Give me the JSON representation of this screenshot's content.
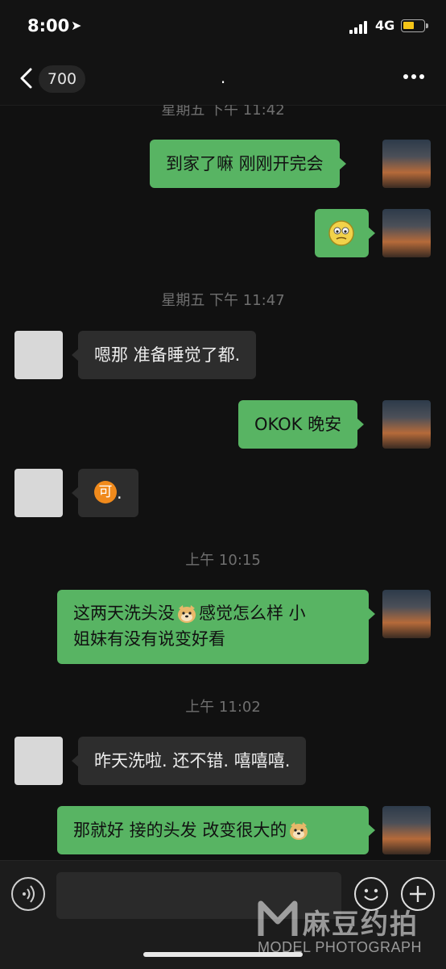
{
  "status_bar": {
    "time": "8:00",
    "network": "4G"
  },
  "navbar": {
    "back_count": "700",
    "title": "."
  },
  "timestamps": {
    "t0": "星期五 下午 11:42",
    "t1": "星期五 下午 11:47",
    "t2": "上午 10:15",
    "t3": "上午 11:02"
  },
  "messages": {
    "m1": "到家了嘛 刚刚开完会",
    "m3": "嗯那 准备睡觉了都.",
    "m4": "OKOK 晚安",
    "m5_suffix": ".",
    "m6_a": "这两天洗头没",
    "m6_b": "感觉怎么样 小",
    "m6_c": "姐妹有没有说变好看",
    "m7": "昨天洗啦. 还不错. 嘻嘻嘻.",
    "m8": "那就好 接的头发 改变很大的"
  },
  "emoji_glyphs": {
    "ke": "可"
  },
  "watermark": {
    "brand": "麻豆约拍",
    "sub": "MODEL PHOTOGRAPH"
  },
  "icons": [
    "location-arrow-icon",
    "signal-icon",
    "battery-icon",
    "back-chevron-icon",
    "more-icon",
    "voice-icon",
    "emoji-icon",
    "plus-icon",
    "sticker-icon",
    "doge-emoji-icon",
    "ke-emoji-icon"
  ],
  "colors": {
    "my_bubble": "#58b463",
    "other_bubble": "#2d2d2d",
    "background": "#111111",
    "battery": "#f5c518"
  }
}
